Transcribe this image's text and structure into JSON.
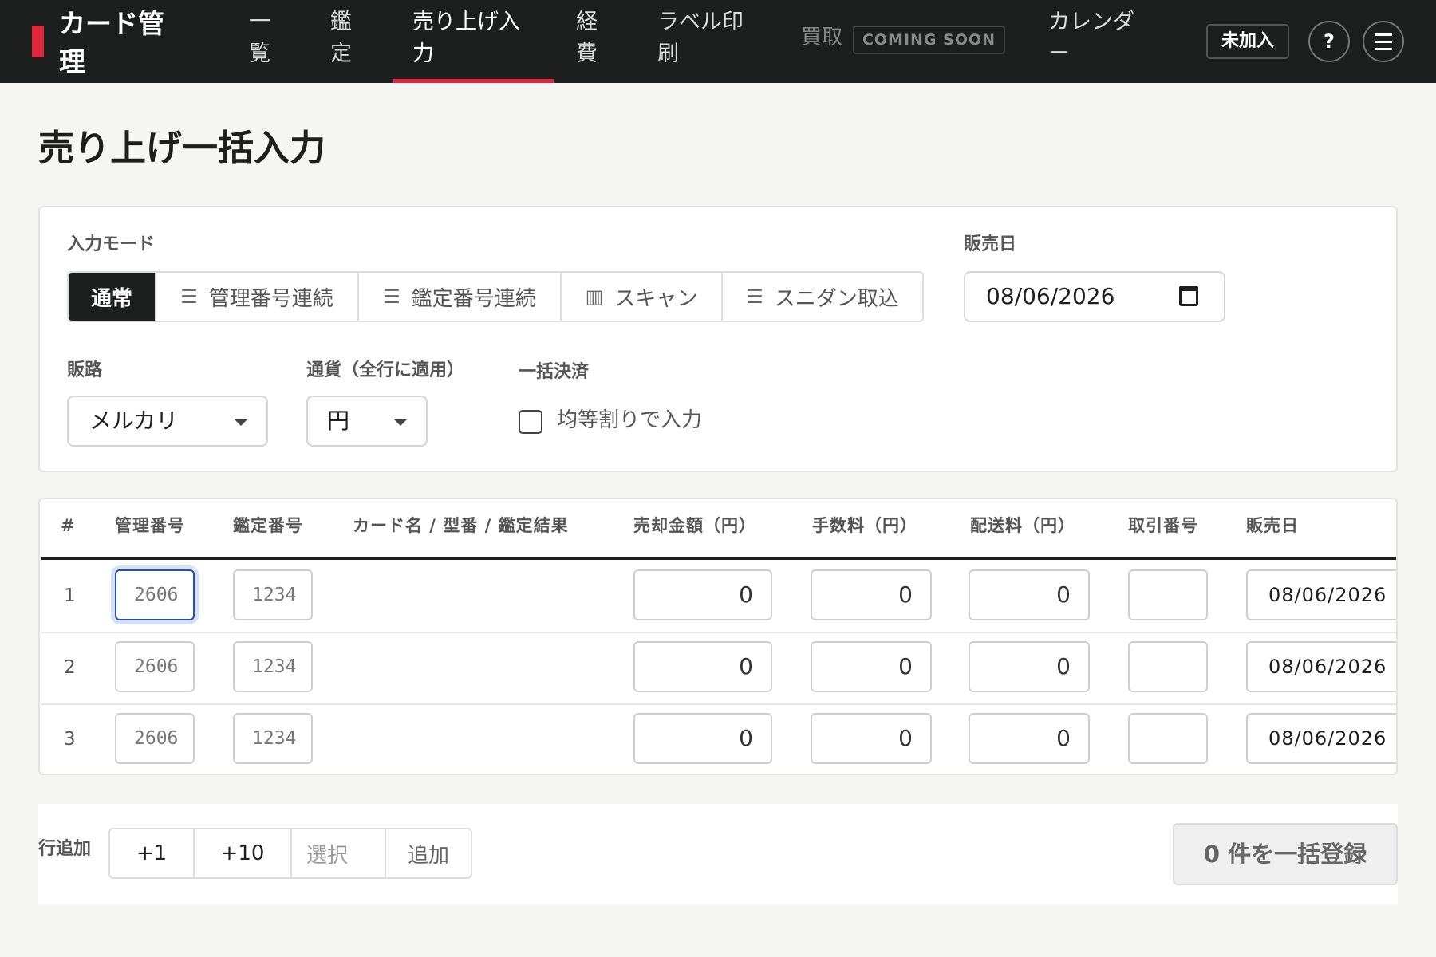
{
  "header": {
    "brand": "カード管理",
    "nav": [
      {
        "label": "一覧"
      },
      {
        "label": "鑑定"
      },
      {
        "label": "売り上げ入力"
      },
      {
        "label": "経費"
      },
      {
        "label": "ラベル印刷"
      },
      {
        "label": "カレンダー"
      }
    ],
    "kaitori": "買取",
    "coming_soon": "COMING SOON",
    "plan_badge": "未加入",
    "help": "?",
    "accent_color": "#e0263a"
  },
  "page": {
    "title": "売り上げ一括入力"
  },
  "form": {
    "mode_label": "入力モード",
    "modes": [
      {
        "label": "通常",
        "icon": ""
      },
      {
        "label": "管理番号連続",
        "icon": "list-icon"
      },
      {
        "label": "鑑定番号連続",
        "icon": "list-icon"
      },
      {
        "label": "スキャン",
        "icon": "barcode-icon"
      },
      {
        "label": "スニダン取込",
        "icon": "list-icon"
      }
    ],
    "sale_date_label": "販売日",
    "sale_date": "08/06/2026",
    "channel_label": "販路",
    "channel": "メルカリ",
    "currency_label": "通貨（全行に適用）",
    "currency": "円",
    "batch_label": "一括決済",
    "batch_checkbox": "均等割りで入力"
  },
  "table": {
    "headers": [
      "#",
      "管理番号",
      "鑑定番号",
      "カード名 / 型番 / 鑑定結果",
      "売却金額（円）",
      "手数料（円）",
      "配送料（円）",
      "取引番号",
      "販売日"
    ],
    "rows": [
      {
        "num": "1",
        "kanri": "2606",
        "kantei": "1234",
        "amount": "0",
        "fee": "0",
        "shipping": "0",
        "txn": "",
        "date": "08/06/2026"
      },
      {
        "num": "2",
        "kanri": "2606",
        "kantei": "1234",
        "amount": "0",
        "fee": "0",
        "shipping": "0",
        "txn": "",
        "date": "08/06/2026"
      },
      {
        "num": "3",
        "kanri": "2606",
        "kantei": "1234",
        "amount": "0",
        "fee": "0",
        "shipping": "0",
        "txn": "",
        "date": "08/06/2026"
      }
    ]
  },
  "footer": {
    "add_row_label": "行追加",
    "add_one": "+1",
    "add_ten": "+10",
    "select_placeholder": "選択",
    "add_label": "追加",
    "submit": "0 件を一括登録"
  }
}
